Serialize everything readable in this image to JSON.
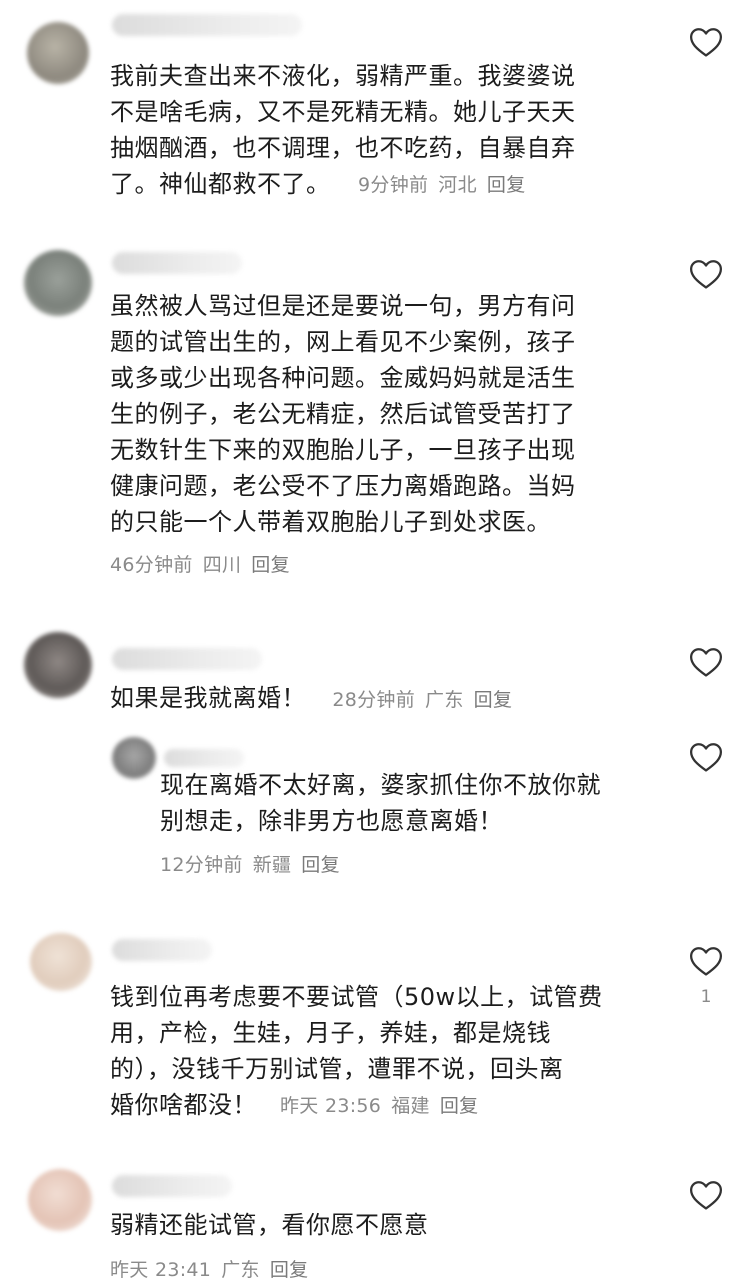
{
  "comments": [
    {
      "text": "我前夫查出来不液化，弱精严重。我婆婆说\n不是啥毛病，又不是死精无精。她儿子天天\n抽烟酗酒，也不调理，也不吃药，自暴自弃\n了。神仙都救不了。",
      "time": "9分钟前",
      "location": "河北",
      "reply_label": "回复"
    },
    {
      "text": "虽然被人骂过但是还是要说一句，男方有问\n题的试管出生的，网上看见不少案例，孩子\n或多或少出现各种问题。金威妈妈就是活生\n生的例子，老公无精症，然后试管受苦打了\n无数针生下来的双胞胎儿子，一旦孩子出现\n健康问题，老公受不了压力离婚跑路。当妈\n的只能一个人带着双胞胎儿子到处求医。",
      "time": "46分钟前",
      "location": "四川",
      "reply_label": "回复"
    },
    {
      "text": "如果是我就离婚！",
      "time": "28分钟前",
      "location": "广东",
      "reply_label": "回复"
    },
    {
      "text": "现在离婚不太好离，婆家抓住你不放你就\n别想走，除非男方也愿意离婚！",
      "time": "12分钟前",
      "location": "新疆",
      "reply_label": "回复"
    },
    {
      "text": "钱到位再考虑要不要试管（50w以上，试管费\n用，产检，生娃，月子，养娃，都是烧钱\n的），没钱千万别试管，遭罪不说，回头离\n婚你啥都没！",
      "time": "昨天 23:56",
      "location": "福建",
      "reply_label": "回复",
      "like_count": "1"
    },
    {
      "text": "弱精还能试管，看你愿不愿意",
      "time": "昨天 23:41",
      "location": "广东",
      "reply_label": "回复"
    }
  ],
  "icons": {
    "like": "heart-outline-icon"
  },
  "colors": {
    "text": "#1c1c1c",
    "meta": "#8a8a8a",
    "icon": "#333333"
  }
}
